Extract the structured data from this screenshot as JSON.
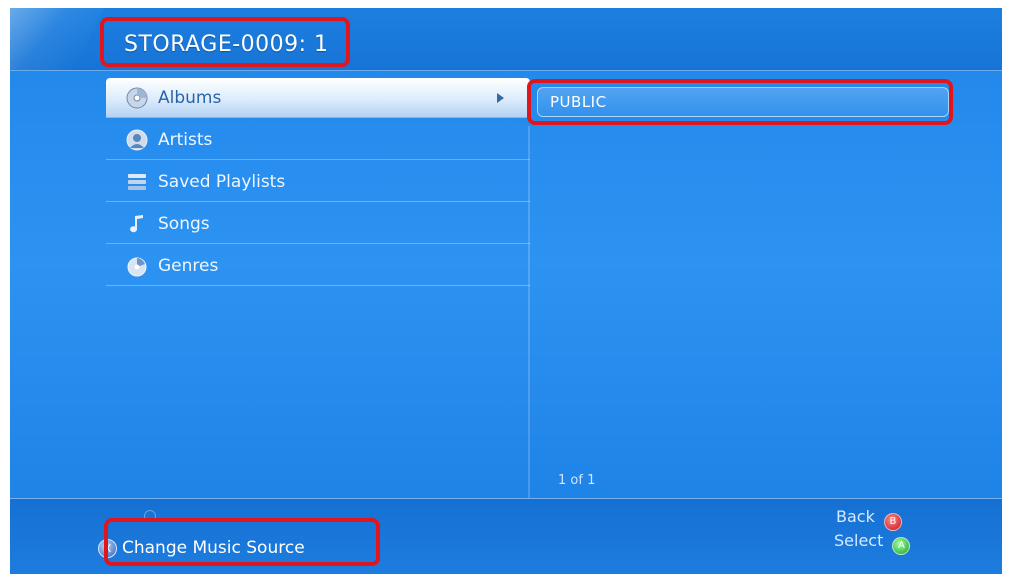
{
  "header": {
    "title": "STORAGE-0009: 1"
  },
  "menu": {
    "items": [
      {
        "label": "Albums",
        "icon": "disc-icon",
        "selected": true
      },
      {
        "label": "Artists",
        "icon": "artist-icon",
        "selected": false
      },
      {
        "label": "Saved Playlists",
        "icon": "playlist-icon",
        "selected": false
      },
      {
        "label": "Songs",
        "icon": "music-note-icon",
        "selected": false
      },
      {
        "label": "Genres",
        "icon": "genre-icon",
        "selected": false
      }
    ]
  },
  "content": {
    "items": [
      {
        "label": "PUBLIC"
      }
    ],
    "pager": "1 of 1"
  },
  "footer": {
    "change_source": {
      "label": "Change Music Source",
      "button": "X"
    },
    "back": {
      "label": "Back",
      "button": "B"
    },
    "select": {
      "label": "Select",
      "button": "A"
    }
  },
  "colors": {
    "background": "#2d93f2",
    "highlight": "#e0161f",
    "back_button": "#c0111a",
    "select_button": "#1e9e2b"
  }
}
